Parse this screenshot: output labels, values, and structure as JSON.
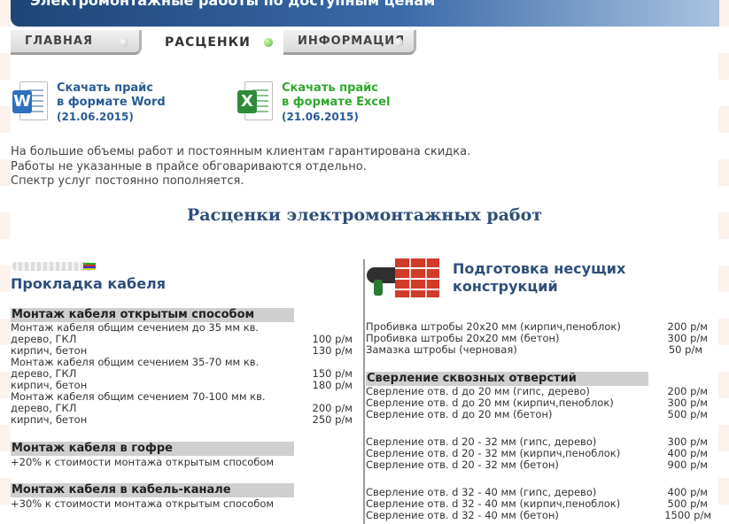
{
  "banner": {
    "title": "Электромонтажные работы по доступным ценам"
  },
  "tabs": [
    {
      "label": "ГЛАВНАЯ"
    },
    {
      "label": "РАСЦЕНКИ"
    },
    {
      "label": "ИНФОРМАЦИЯ"
    }
  ],
  "downloads": {
    "word": {
      "line1": "Скачать прайс",
      "line2": "в формате Word",
      "date": "(21.06.2015)",
      "icon": "word-icon"
    },
    "excel": {
      "line1": "Скачать прайс",
      "line2": "в формате Excel",
      "date": "(21.06.2015)",
      "icon": "excel-icon"
    }
  },
  "notes": [
    "На большие объемы работ и постоянным клиентам гарантирована скидка.",
    "Работы не указанные в прайсе обговариваются отдельно.",
    "Спектр услуг постоянно пополняется."
  ],
  "page_title": "Расценки электромонтажных работ",
  "left": {
    "title": "Прокладка кабеля",
    "icon": "cable-icon",
    "open": {
      "header": "Монтаж кабеля открытым способом",
      "rows": [
        {
          "label": "Монтаж кабеля общим сечением до 35 мм кв.",
          "price": ""
        },
        {
          "label": "дерево, ГКЛ",
          "price": "100 р/м"
        },
        {
          "label": "кирпич, бетон",
          "price": "130 р/м"
        },
        {
          "label": "Монтаж кабеля общим сечением 35-70 мм кв.",
          "price": ""
        },
        {
          "label": "дерево, ГКЛ",
          "price": "150 р/м"
        },
        {
          "label": "кирпич, бетон",
          "price": "180 р/м"
        },
        {
          "label": "Монтаж кабеля общим сечением 70-100 мм кв.",
          "price": ""
        },
        {
          "label": "дерево, ГКЛ",
          "price": "200 р/м"
        },
        {
          "label": "кирпич, бетон",
          "price": "250 р/м"
        }
      ]
    },
    "gofre": {
      "header": "Монтаж кабеля в гофре",
      "text": "+20% к стоимости монтажа открытым способом"
    },
    "channel": {
      "header": "Монтаж кабеля в кабель-канале",
      "text": "+30% к стоимости монтажа открытым способом"
    }
  },
  "right": {
    "title_line1": "Подготовка несущих",
    "title_line2": "конструкций",
    "icon": "drill-wall-icon",
    "chasing": [
      {
        "label": "Пробивка штробы 20х20 мм (кирпич,пеноблок)",
        "price": "200 р/м"
      },
      {
        "label": "Пробивка штробы 20х20 мм (бетон)",
        "price": "300 р/м"
      },
      {
        "label": "Замазка штробы (черновая)",
        "price": "50 р/м"
      }
    ],
    "drilling": {
      "header": "Сверление сквозных отверстий",
      "group1": [
        {
          "label": "Сверление отв. d до 20 мм (гипс, дерево)",
          "price": "200 р/м"
        },
        {
          "label": "Сверление отв. d до 20 мм (кирпич,пеноблок)",
          "price": "300 р/м"
        },
        {
          "label": "Сверление отв. d до 20 мм (бетон)",
          "price": "500 р/м"
        }
      ],
      "group2": [
        {
          "label": "Сверление отв. d 20 - 32 мм (гипс, дерево)",
          "price": "300 р/м"
        },
        {
          "label": "Сверление отв. d 20 - 32 мм (кирпич,пеноблок)",
          "price": "400 р/м"
        },
        {
          "label": "Сверление отв. d 20 - 32 мм (бетон)",
          "price": "900 р/м"
        }
      ],
      "group3": [
        {
          "label": "Сверление отв. d 32 - 40 мм (гипс, дерево)",
          "price": "400 р/м"
        },
        {
          "label": "Сверление отв. d 32 - 40 мм (кирпич,пеноблок)",
          "price": "500 р/м"
        },
        {
          "label": "Сверление отв. d 32 - 40 мм (бетон)",
          "price": "1500 р/м"
        }
      ]
    }
  }
}
